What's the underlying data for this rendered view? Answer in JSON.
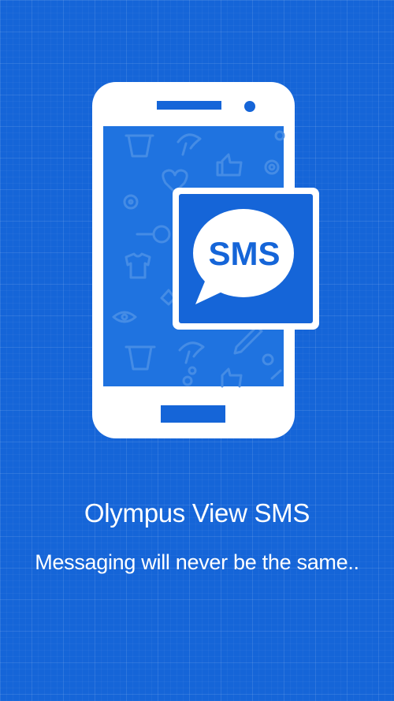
{
  "app": {
    "title": "Olympus View SMS",
    "tagline": "Messaging will never be the same..",
    "badge_text": "SMS"
  },
  "colors": {
    "background": "#1565d8",
    "foreground": "#ffffff",
    "screen": "#1f73e0"
  },
  "icons": [
    "phone-icon",
    "sms-bubble-icon",
    "cup-icon",
    "mushroom-icon",
    "thumbs-up-icon",
    "gear-icon",
    "heart-icon",
    "search-icon",
    "tshirt-icon",
    "eye-icon",
    "pencil-icon"
  ]
}
